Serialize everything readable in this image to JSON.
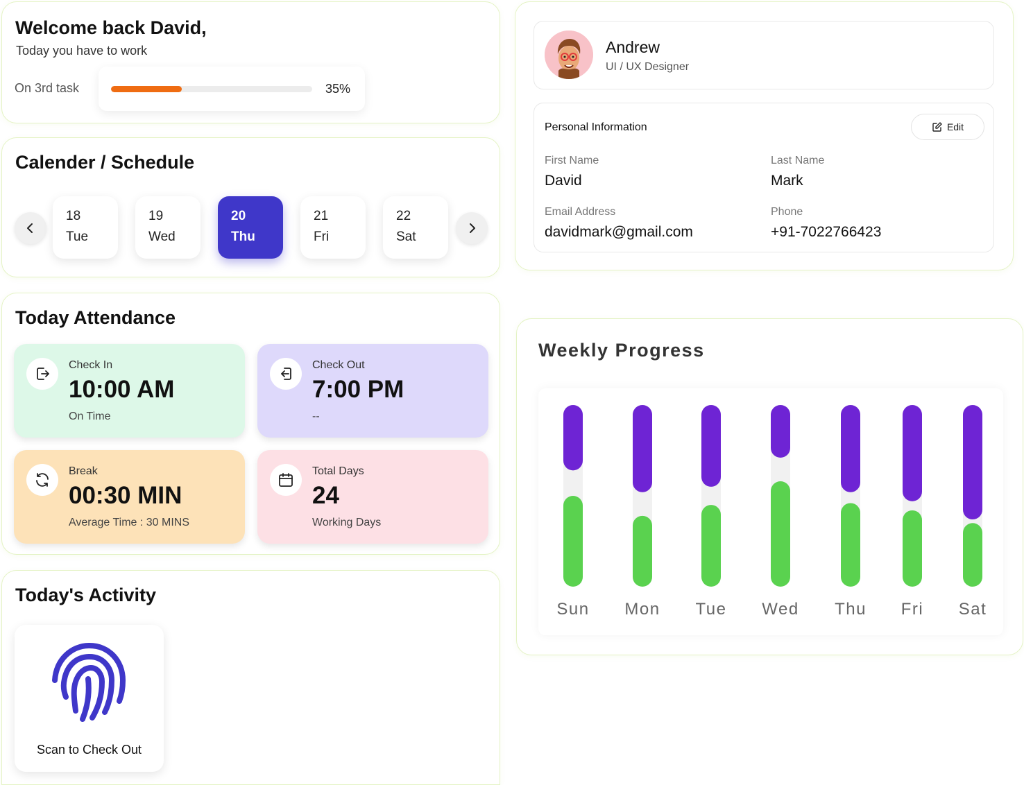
{
  "welcome": {
    "title": "Welcome back David,",
    "subtitle": "Today you have to work",
    "task_label": "On 3rd task",
    "progress": 0.35,
    "progress_label": "35%",
    "progress_color": "#ef6c12"
  },
  "calendar": {
    "title": "Calender / Schedule",
    "prev_icon": "chevron-left-icon",
    "next_icon": "chevron-right-icon",
    "days": [
      {
        "num": "18",
        "weekday": "Tue",
        "active": false
      },
      {
        "num": "19",
        "weekday": "Wed",
        "active": false
      },
      {
        "num": "20",
        "weekday": "Thu",
        "active": true
      },
      {
        "num": "21",
        "weekday": "Fri",
        "active": false
      },
      {
        "num": "22",
        "weekday": "Sat",
        "active": false
      }
    ],
    "active_color": "#3f37c9"
  },
  "attendance": {
    "title": "Today Attendance",
    "cards": [
      {
        "label": "Check In",
        "value": "10:00 AM",
        "sub": "On Time",
        "icon": "check-in-icon",
        "bg": "#ddf8e8"
      },
      {
        "label": "Check Out",
        "value": "7:00 PM",
        "sub": "--",
        "icon": "check-out-icon",
        "bg": "#ded9fb"
      },
      {
        "label": "Break",
        "value": "00:30 MIN",
        "sub": "Average Time : 30 MINS",
        "icon": "refresh-icon",
        "bg": "#fde2b8"
      },
      {
        "label": "Total Days",
        "value": "24",
        "sub": "Working Days",
        "icon": "calendar-icon",
        "bg": "#fde0e5"
      }
    ]
  },
  "activity": {
    "title": "Today's Activity",
    "scan_label": "Scan to Check Out",
    "scan_icon": "fingerprint-icon",
    "scan_color": "#3f37c9"
  },
  "profile": {
    "name": "Andrew",
    "role": "UI / UX Designer",
    "avatar_bg": "#f8c2c8",
    "info_heading": "Personal Information",
    "edit_label": "Edit",
    "fields": {
      "first_name_label": "First Name",
      "first_name": "David",
      "last_name_label": "Last Name",
      "last_name": "Mark",
      "email_label": "Email Address",
      "email": "davidmark@gmail.com",
      "phone_label": "Phone",
      "phone": "+91-7022766423"
    }
  },
  "weekly": {
    "title": "Weekly Progress"
  },
  "chart_data": {
    "type": "bar",
    "stacked": true,
    "categories": [
      "Sun",
      "Mon",
      "Tue",
      "Wed",
      "Thu",
      "Fri",
      "Sat"
    ],
    "series": [
      {
        "color": "#5ad24f",
        "values": [
          0.5,
          0.39,
          0.45,
          0.58,
          0.46,
          0.42,
          0.35
        ]
      },
      {
        "color": "#6e24d4",
        "values": [
          0.36,
          0.48,
          0.45,
          0.29,
          0.48,
          0.53,
          0.63
        ]
      }
    ],
    "track_color": "#f1f1f1",
    "grid": false
  }
}
